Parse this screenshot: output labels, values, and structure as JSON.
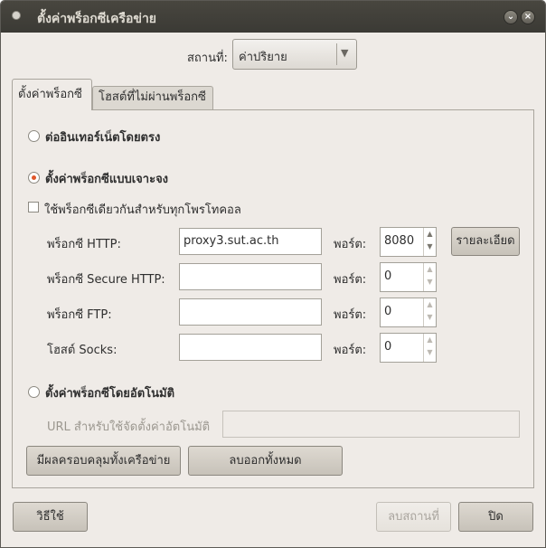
{
  "window": {
    "title": "ตั้งค่าพร็อกซีเครือข่าย"
  },
  "location": {
    "label": "สถานที่:",
    "value": "ค่าปริยาย"
  },
  "tabs": [
    {
      "label": "ตั้งค่าพร็อกซี",
      "active": true
    },
    {
      "label": "โฮสต์ที่ไม่ผ่านพร็อกซี",
      "active": false
    }
  ],
  "proxy": {
    "direct_label": "ต่ออินเทอร์เน็ตโดยตรง",
    "manual_label": "ตั้งค่าพร็อกซีแบบเจาะจง",
    "same_proxy_label": "ใช้พร็อกซีเดียวกันสำหรับทุกโพรโทคอล",
    "port_label": "พอร์ต:",
    "details_label": "รายละเอียด",
    "rows": [
      {
        "label": "พร็อกซี HTTP:",
        "host": "proxy3.sut.ac.th",
        "port": "8080"
      },
      {
        "label": "พร็อกซี Secure HTTP:",
        "host": "",
        "port": "0"
      },
      {
        "label": "พร็อกซี FTP:",
        "host": "",
        "port": "0"
      },
      {
        "label": "โฮสต์ Socks:",
        "host": "",
        "port": "0"
      }
    ],
    "auto_label": "ตั้งค่าพร็อกซีโดยอัตโนมัติ",
    "auto_url_label": "URL สำหรับใช้จัดตั้งค่าอัตโนมัติ",
    "auto_url_value": "",
    "apply_all_label": "มีผลครอบคลุมทั้งเครือข่าย",
    "clear_all_label": "ลบออกทั้งหมด"
  },
  "footer": {
    "help_label": "วิธีใช้",
    "delete_location_label": "ลบสถานที่",
    "close_label": "ปิด"
  }
}
